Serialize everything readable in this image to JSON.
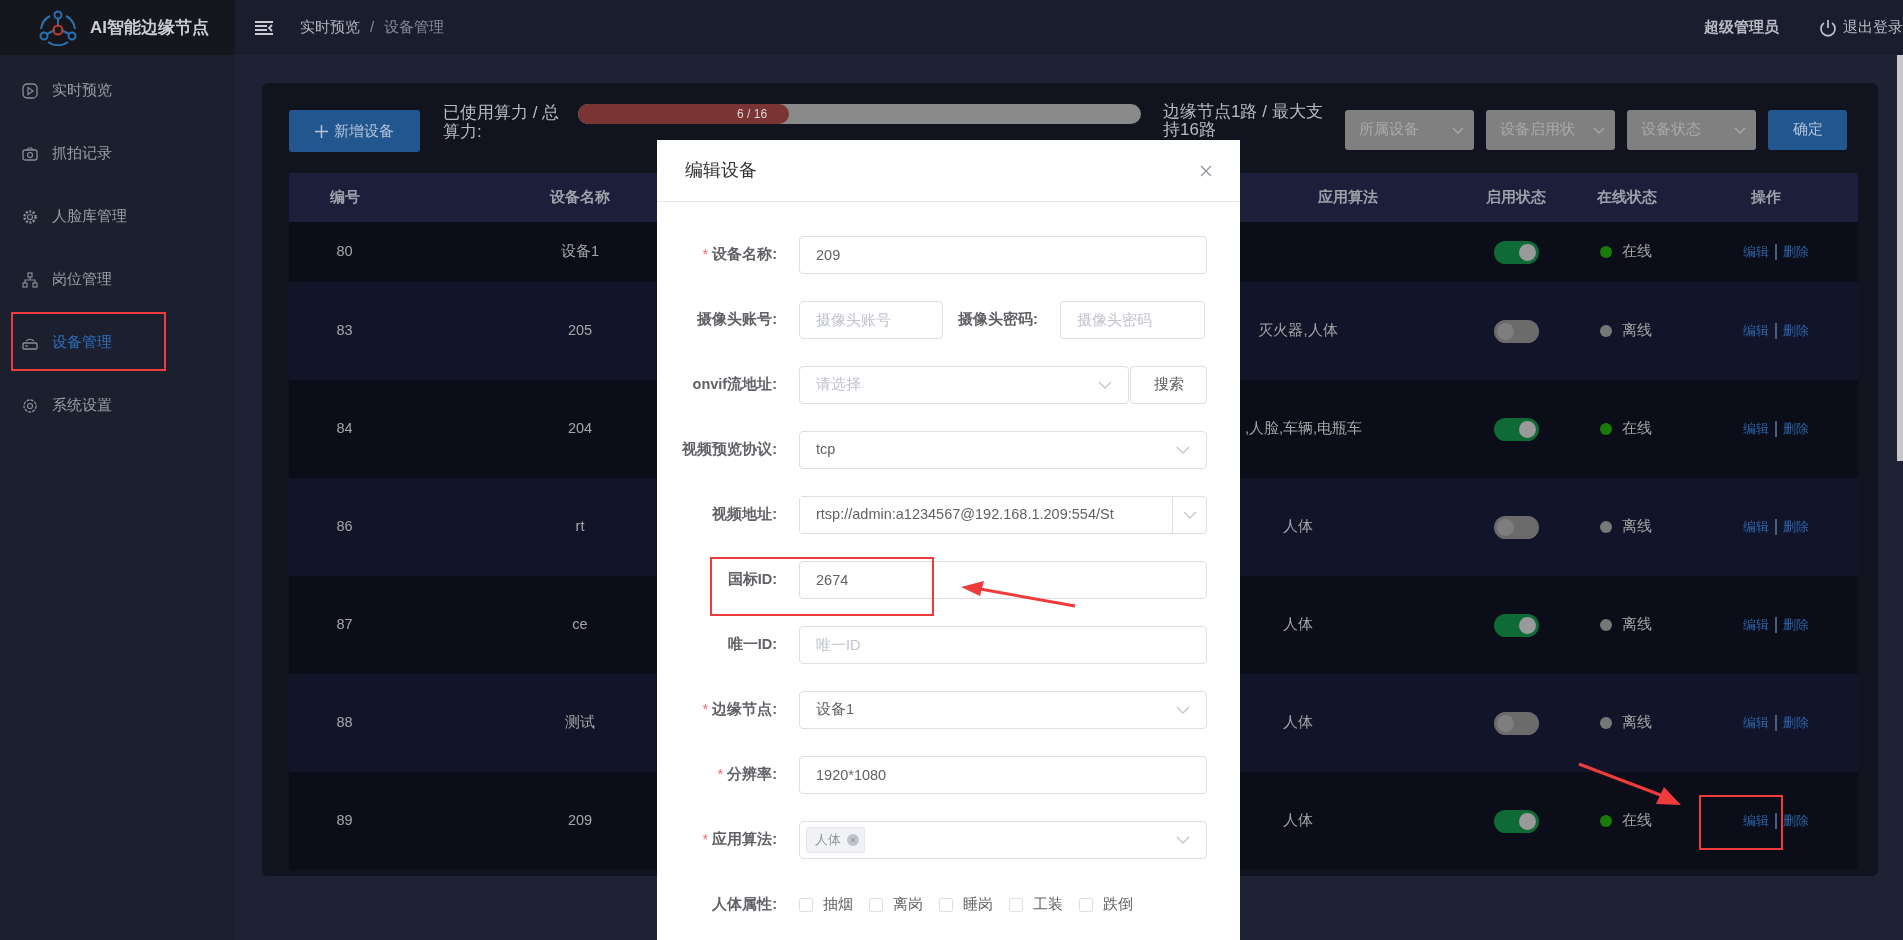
{
  "app": {
    "title": "AI智能边缘节点"
  },
  "sidebar": {
    "items": [
      {
        "label": "实时预览",
        "selected": false
      },
      {
        "label": "抓拍记录",
        "selected": false
      },
      {
        "label": "人脸库管理",
        "selected": false
      },
      {
        "label": "岗位管理",
        "selected": false
      },
      {
        "label": "设备管理",
        "selected": true
      },
      {
        "label": "系统设置",
        "selected": false
      }
    ]
  },
  "breadcrumb": {
    "items": [
      "实时预览",
      "设备管理"
    ],
    "separator": "/"
  },
  "user": {
    "name": "超级管理员",
    "logout": "退出登录"
  },
  "toolbar": {
    "add_button": "新增设备",
    "usage_label": "已使用算力 / 总算力:",
    "usage": {
      "level": 0.375,
      "reading": "6 / 16"
    },
    "capacity": "边缘节点1路 / 最大支持16路",
    "filters": [
      {
        "placeholder": "所属设备"
      },
      {
        "placeholder": "设备启用状"
      },
      {
        "placeholder": "设备状态"
      }
    ],
    "confirm": "确定"
  },
  "table": {
    "columns": [
      "编号",
      "设备名称",
      "应用算法",
      "启用状态",
      "在线状态",
      "操作"
    ],
    "rows": [
      {
        "id": "80",
        "name": "设备1",
        "enabled": true,
        "online": true,
        "status": "在线",
        "actions": [
          "编辑",
          "删除"
        ]
      },
      {
        "id": "83",
        "name": "205",
        "algorithms": "灭火器,人体",
        "enabled": false,
        "online": false,
        "status": "离线",
        "actions": [
          "编辑",
          "删除"
        ]
      },
      {
        "id": "84",
        "name": "204",
        "algorithms": ",人脸,车辆,电瓶车",
        "enabled": true,
        "online": true,
        "status": "在线",
        "actions": [
          "编辑",
          "删除"
        ]
      },
      {
        "id": "86",
        "name": "rt",
        "algorithms": "人体",
        "enabled": false,
        "online": false,
        "status": "离线",
        "actions": [
          "编辑",
          "删除"
        ]
      },
      {
        "id": "87",
        "name": "ce",
        "algorithms": "人体",
        "enabled": true,
        "online": false,
        "status": "离线",
        "actions": [
          "编辑",
          "删除"
        ]
      },
      {
        "id": "88",
        "name": "测试",
        "algorithms": "人体",
        "enabled": false,
        "online": false,
        "status": "离线",
        "actions": [
          "编辑",
          "删除"
        ]
      },
      {
        "id": "89",
        "name": "209",
        "algorithms": "人体",
        "enabled": true,
        "online": true,
        "status": "在线",
        "actions": [
          "编辑",
          "删除"
        ]
      }
    ]
  },
  "modal": {
    "title": "编辑设备",
    "fields": [
      {
        "kind": "text",
        "marker": "*",
        "label": "设备名称:",
        "value": "209"
      },
      {
        "kind": "pair",
        "label": "摄像头账号:",
        "placeholder": "摄像头账号",
        "label_2": "摄像头密码:",
        "placeholder_2": "摄像头密码"
      },
      {
        "kind": "select_search",
        "label": "onvif流地址:",
        "placeholder": "请选择",
        "button": "搜索"
      },
      {
        "kind": "select",
        "label": "视频预览协议:",
        "value": "tcp"
      },
      {
        "kind": "combo",
        "label": "视频地址:",
        "value": "rtsp://admin:a1234567@192.168.1.209:554/St"
      },
      {
        "kind": "text",
        "label": "国标ID:",
        "value": "2674"
      },
      {
        "kind": "text",
        "label": "唯一ID:",
        "placeholder": "唯一ID"
      },
      {
        "kind": "select",
        "marker": "*",
        "label": "边缘节点:",
        "value": "设备1"
      },
      {
        "kind": "text",
        "marker": "*",
        "label": "分辨率:",
        "value": "1920*1080"
      },
      {
        "kind": "tags",
        "marker": "*",
        "label": "应用算法:",
        "tags": [
          "人体"
        ]
      },
      {
        "kind": "checkboxes",
        "label": "人体属性:",
        "options": [
          {
            "label": "抽烟",
            "checked": false
          },
          {
            "label": "离岗",
            "checked": false
          },
          {
            "label": "睡岗",
            "checked": false
          },
          {
            "label": "工装",
            "checked": false
          },
          {
            "label": "跌倒",
            "checked": false
          }
        ]
      }
    ]
  }
}
